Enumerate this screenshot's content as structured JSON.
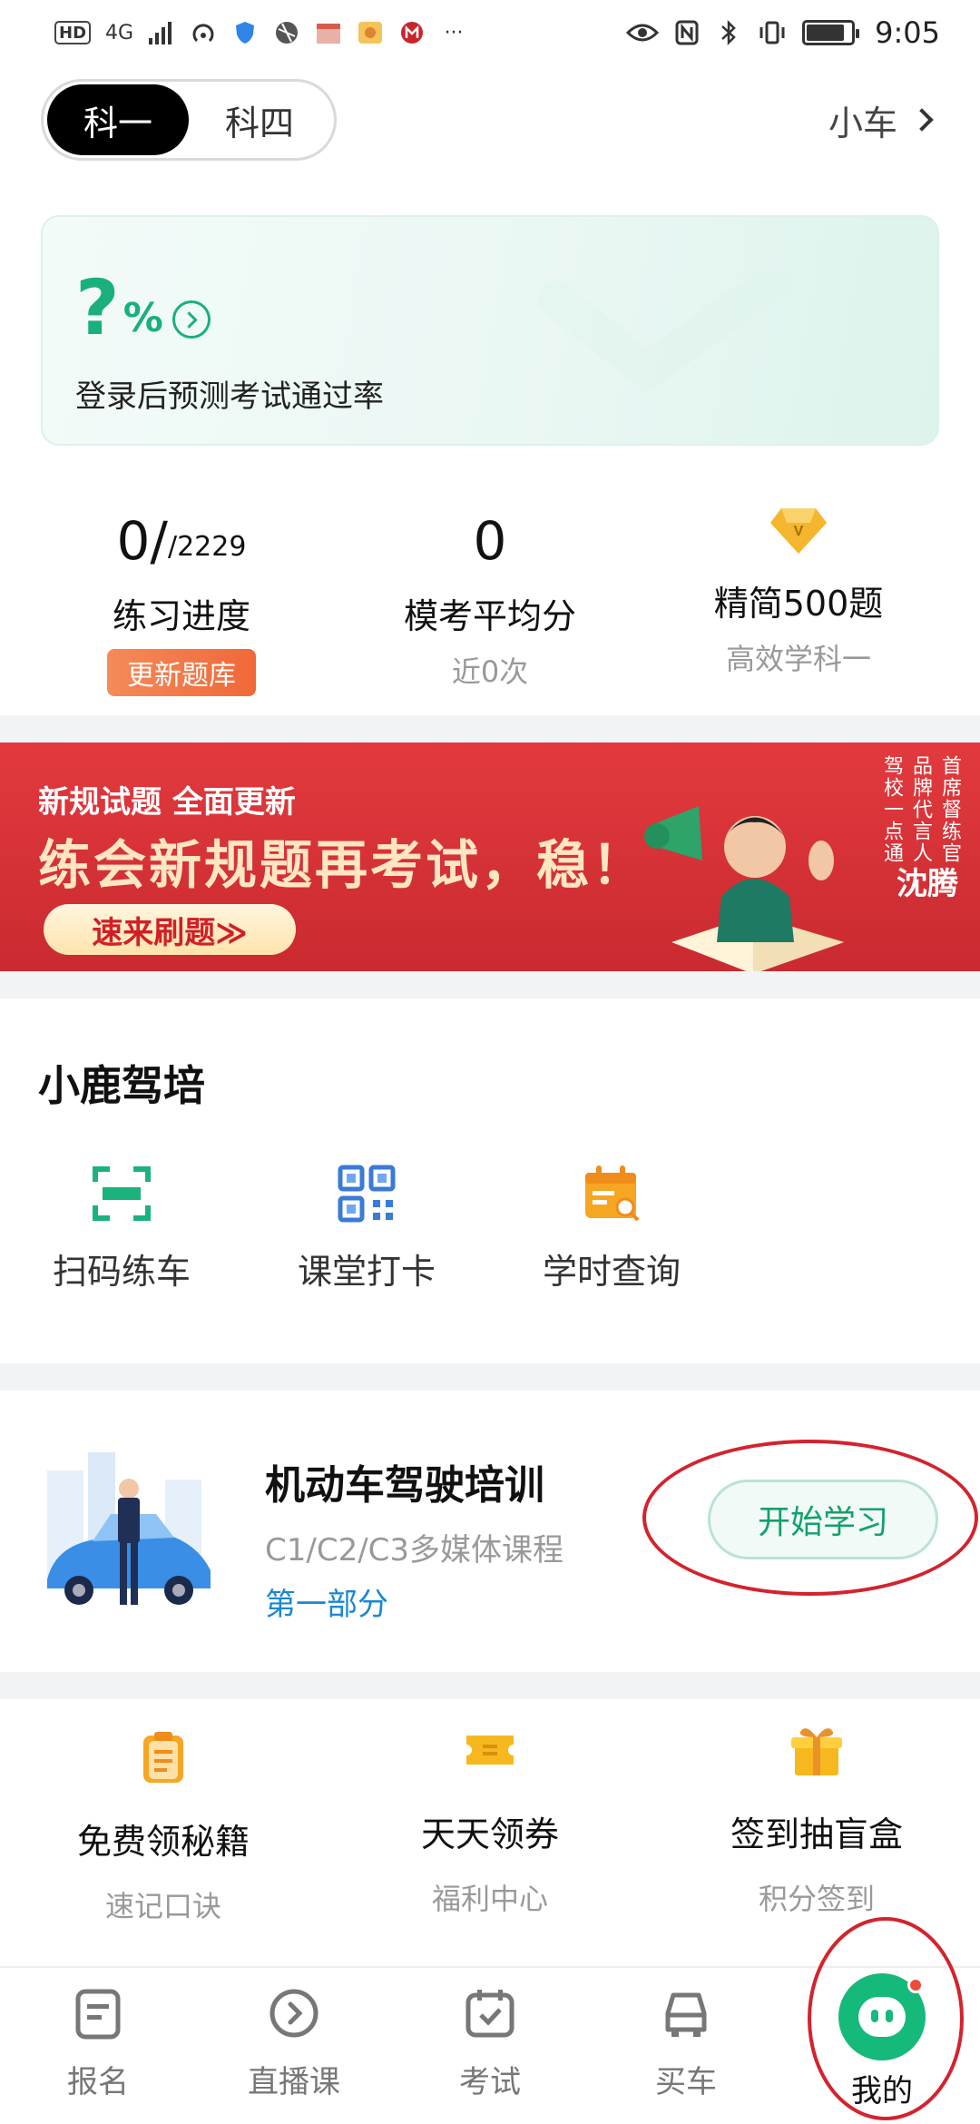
{
  "status_bar": {
    "time": "9:05",
    "network": "4G",
    "hd": "HD",
    "more": "···",
    "battery_fraction": 0.85
  },
  "header": {
    "subject_tabs": [
      "科一",
      "科四"
    ],
    "active_tab": "科一",
    "car_type": "小车"
  },
  "pass_card": {
    "rate": "?",
    "percent": "%",
    "description": "登录后预测考试通过率"
  },
  "stats": {
    "progress": {
      "value": "0/",
      "total": "/2229",
      "label": "练习进度",
      "badge": "更新题库"
    },
    "mock": {
      "value": "0",
      "label": "模考平均分",
      "sub": "近0次"
    },
    "vip": {
      "label": "精简500题",
      "sub": "高效学科一",
      "icon": "vip-diamond-icon"
    }
  },
  "banner": {
    "line1": "新规试题 全面更新",
    "line2": "练会新规题再考试，稳！",
    "button": "速来刷题≫",
    "vertical_cols": [
      "首席督练官",
      "品牌代言人",
      "驾校一点通"
    ],
    "name": "沈腾"
  },
  "school": {
    "title": "小鹿驾培",
    "items": [
      {
        "label": "扫码练车",
        "icon": "scan-icon"
      },
      {
        "label": "课堂打卡",
        "icon": "qr-code-icon"
      },
      {
        "label": "学时查询",
        "icon": "calendar-search-icon"
      }
    ]
  },
  "course": {
    "title": "机动车驾驶培训",
    "subtitle": "C1/C2/C3多媒体课程",
    "part": "第一部分",
    "button": "开始学习"
  },
  "benefits": [
    {
      "title": "免费领秘籍",
      "sub": "速记口诀",
      "icon": "clipboard-icon"
    },
    {
      "title": "天天领券",
      "sub": "福利中心",
      "icon": "ticket-icon"
    },
    {
      "title": "签到抽盲盒",
      "sub": "积分签到",
      "icon": "gift-icon"
    }
  ],
  "tabbar": [
    {
      "label": "报名",
      "icon": "form-icon"
    },
    {
      "label": "直播课",
      "icon": "play-icon"
    },
    {
      "label": "考试",
      "icon": "check-calendar-icon"
    },
    {
      "label": "买车",
      "icon": "car-icon"
    },
    {
      "label": "我的",
      "icon": "mascot-icon"
    }
  ],
  "colors": {
    "accent_green": "#19b07c",
    "banner_red": "#d62f35",
    "annotation_red": "#d3232e",
    "link_blue": "#1a88d1",
    "badge_orange": "#f06838"
  }
}
